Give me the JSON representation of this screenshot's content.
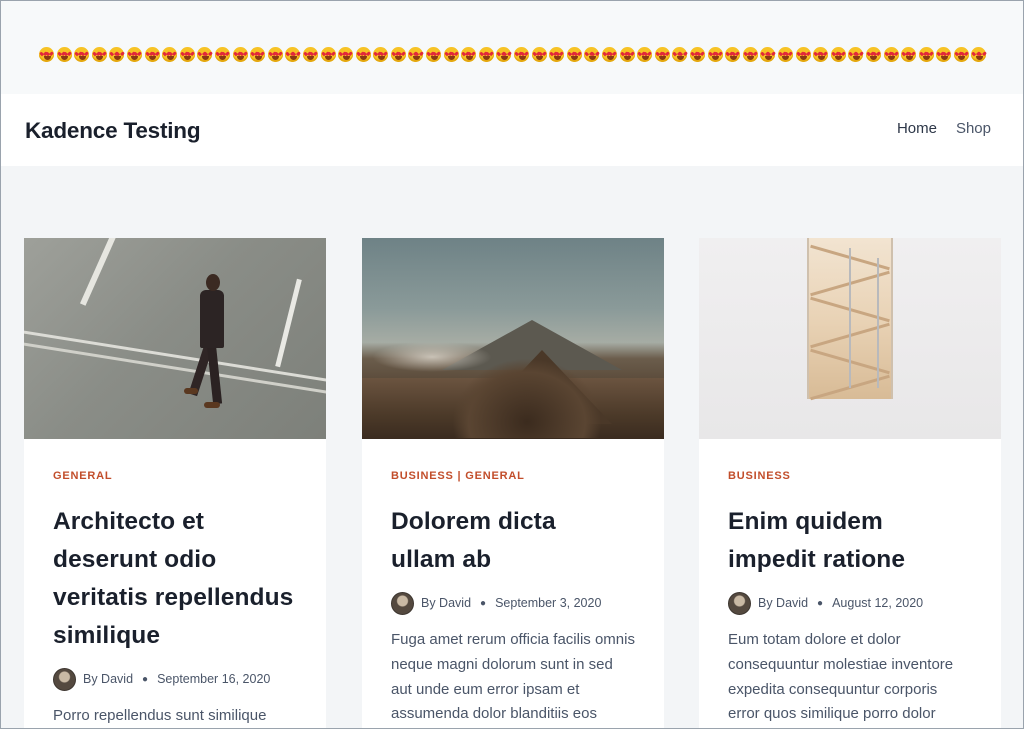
{
  "banner": {
    "emoji": "😍",
    "emoji_count": 54
  },
  "header": {
    "site_title": "Kadence Testing",
    "nav": [
      {
        "label": "Home"
      },
      {
        "label": "Shop"
      }
    ]
  },
  "posts": [
    {
      "categories": "GENERAL",
      "title": "Architecto et deserunt odio veritatis repellendus similique",
      "author": "By David",
      "date": "September 16, 2020",
      "excerpt": "Porro repellendus sunt similique",
      "image": "man-walking-on-road"
    },
    {
      "categories": "BUSINESS | GENERAL",
      "title": "Dolorem dicta ullam ab",
      "author": "By David",
      "date": "September 3, 2020",
      "excerpt": "Fuga amet rerum officia facilis omnis neque magni dolorum sunt in sed aut unde eum error ipsam et assumenda dolor blanditiis eos",
      "image": "volcano-landscape"
    },
    {
      "categories": "BUSINESS",
      "title": "Enim quidem impedit ratione",
      "author": "By David",
      "date": "August 12, 2020",
      "excerpt": "Eum totam dolore et dolor consequuntur molestiae inventore expedita consequuntur corporis error quos similique porro dolor",
      "image": "stairwell"
    }
  ],
  "colors": {
    "accent": "#c24e2b",
    "background": "#f3f5f7",
    "title": "#1a202c",
    "text": "#4a5568"
  }
}
